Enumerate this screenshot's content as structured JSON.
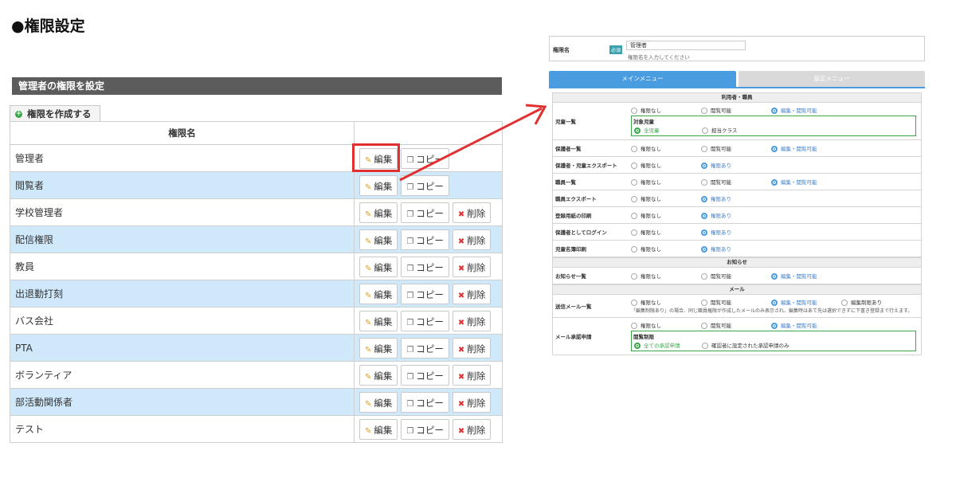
{
  "page_title": "●権限設定",
  "left": {
    "section_title": "管理者の権限を設定",
    "create_button": "権限を作成する",
    "table_header": "権限名",
    "buttons": {
      "edit": "編集",
      "copy": "コピー",
      "delete": "削除"
    },
    "roles": [
      {
        "name": "管理者",
        "deletable": false
      },
      {
        "name": "閲覧者",
        "deletable": false
      },
      {
        "name": "学校管理者",
        "deletable": true
      },
      {
        "name": "配信権限",
        "deletable": true
      },
      {
        "name": "教員",
        "deletable": true
      },
      {
        "name": "出退勤打刻",
        "deletable": true
      },
      {
        "name": "バス会社",
        "deletable": true
      },
      {
        "name": "PTA",
        "deletable": true
      },
      {
        "name": "ボランティア",
        "deletable": true
      },
      {
        "name": "部活動関係者",
        "deletable": true
      },
      {
        "name": "テスト",
        "deletable": true
      }
    ]
  },
  "right": {
    "name_label": "権限名",
    "required_badge": "必須",
    "name_value": "管理者",
    "name_hint": "権限名を入力してください",
    "tab_main": "メインメニュー",
    "tab_settings": "設定メニュー",
    "group_users": "利用者・職員",
    "group_notice": "お知らせ",
    "group_mail": "メール",
    "opt_none": "権限なし",
    "opt_view": "閲覧可能",
    "opt_edit": "編集・閲覧可能",
    "opt_has": "権限あり",
    "opt_edit_limited": "編集制限あり",
    "row_children": "児童一覧",
    "target_children": "対象児童",
    "all_children": "全児童",
    "class_in_charge": "担当クラス",
    "row_guardians": "保護者一覧",
    "row_guardian_export": "保護者・児童エクスポート",
    "row_staff": "職員一覧",
    "row_staff_export": "職員エクスポート",
    "row_register_print": "登録用紙の印刷",
    "row_guardian_login": "保護者としてログイン",
    "row_roster_print": "児童名簿印刷",
    "row_notice_list": "お知らせ一覧",
    "row_sent_mail": "送信メール一覧",
    "mail_note": "「編集制限あり」の場合、同じ職員権限が作成したメールのみ表示され、編集時はあて先は選択できずに下書き登録まで行えます。",
    "row_mail_approval": "メール承認申請",
    "approval_scope": "閲覧制限",
    "all_approvals": "全ての承認申請",
    "approver_only": "確認者に設定された承認申請のみ"
  },
  "colors": {
    "section_bar": "#5c5c5c",
    "row_highlight": "#cfe9fb",
    "accent_red": "#e03030",
    "tab_active": "#4a9ce0",
    "tab_inactive": "#d9d9d9",
    "success_green": "#3aa54a"
  }
}
